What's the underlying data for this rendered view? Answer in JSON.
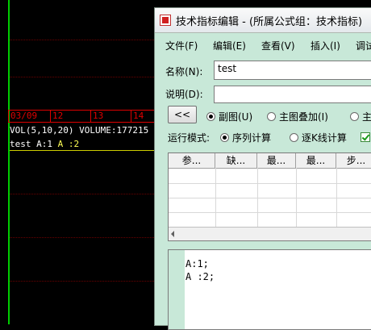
{
  "chart": {
    "dates": [
      "03/09",
      "12",
      "13",
      "14"
    ],
    "volume_line": "VOL(5,10,20) VOLUME:177215",
    "indicator_line": {
      "name": "test",
      "a1": "A:1",
      "a2": "A :2"
    }
  },
  "window": {
    "title": "技术指标编辑 - (所属公式组：技术指标)",
    "menu": [
      "文件(F)",
      "编辑(E)",
      "查看(V)",
      "插入(I)",
      "调试"
    ],
    "name_label": "名称(N):",
    "name_value": "test",
    "desc_label": "说明(D):",
    "desc_value": "",
    "collapse_button": "<<",
    "display_options": [
      {
        "label": "副图(U)",
        "selected": true
      },
      {
        "label": "主图叠加(I)",
        "selected": false
      },
      {
        "label": "主",
        "selected": false
      }
    ],
    "run_mode_label": "运行模式:",
    "run_modes": [
      {
        "label": "序列计算",
        "selected": true
      },
      {
        "label": "逐K线计算",
        "selected": false
      }
    ],
    "param_columns": [
      "参...",
      "缺...",
      "最...",
      "最...",
      "步..."
    ],
    "code_lines": [
      "A:1;",
      "A :2;"
    ]
  }
}
